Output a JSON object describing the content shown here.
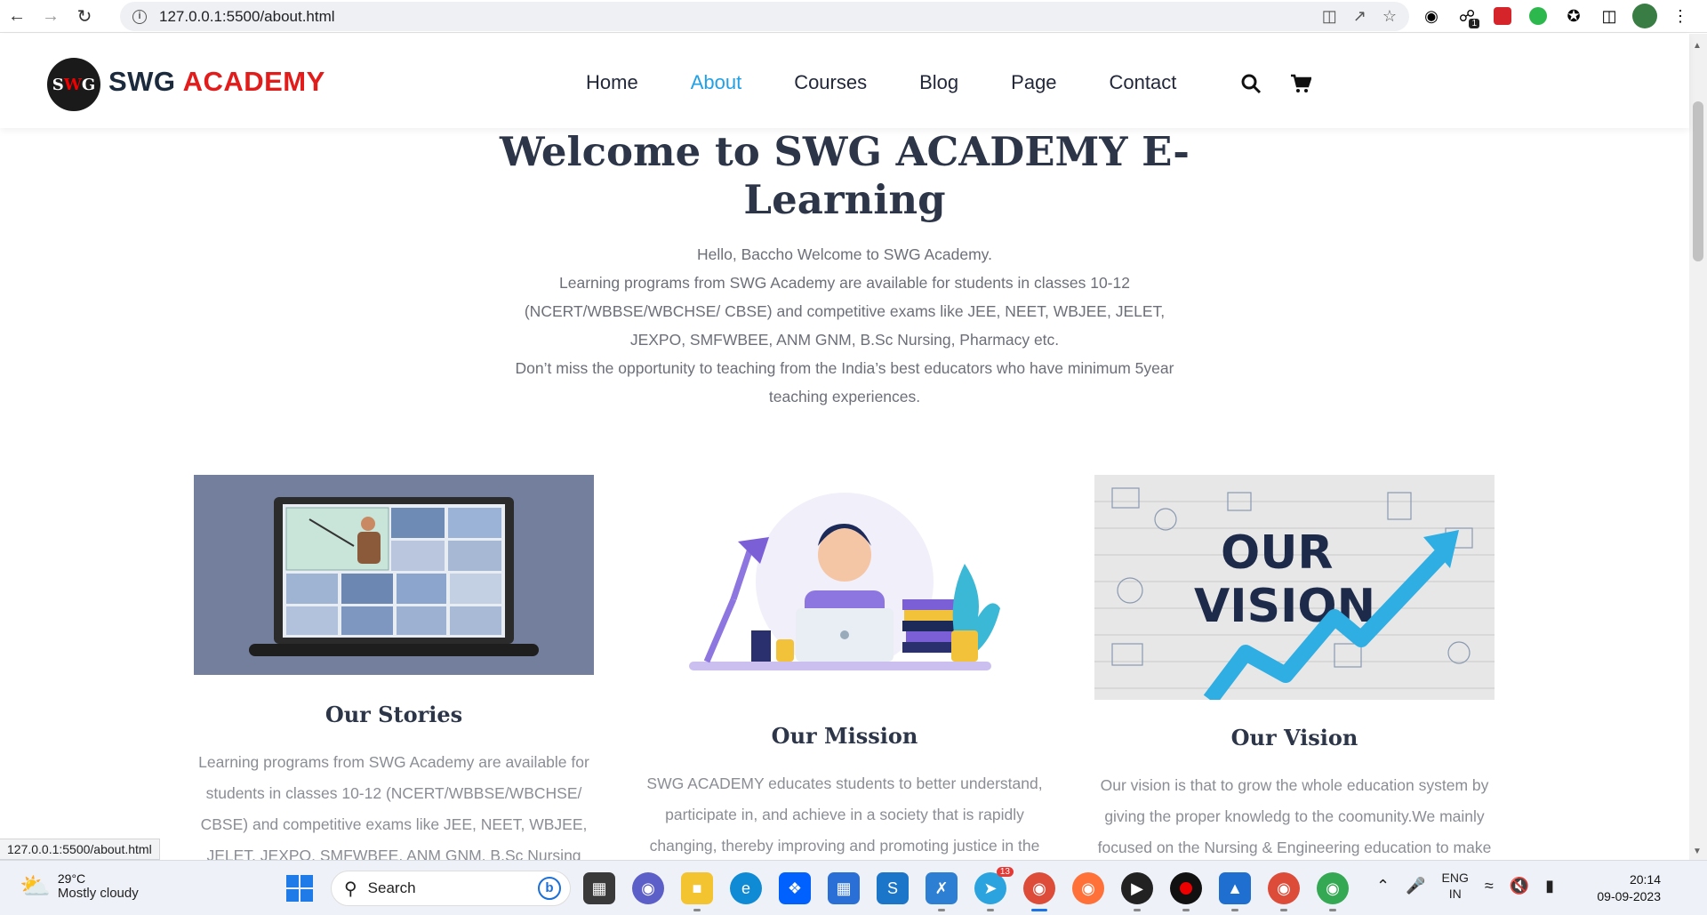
{
  "browser": {
    "url": "127.0.0.1:5500/about.html",
    "status_url": "127.0.0.1:5500/about.html",
    "extensions": [
      "cookie-icon",
      "link-icon",
      "pdf-icon",
      "green-app-icon",
      "puzzle-icon",
      "sidepanel-icon"
    ],
    "ext_badge": "1"
  },
  "header": {
    "logo_text_a": "S",
    "logo_text_b": "G",
    "logo_text_w": "W",
    "brand_part1": "SWG",
    "brand_part2": "ACADEMY",
    "menu": [
      {
        "label": "Home",
        "active": false
      },
      {
        "label": "About",
        "active": true
      },
      {
        "label": "Courses",
        "active": false
      },
      {
        "label": "Blog",
        "active": false
      },
      {
        "label": "Page",
        "active": false
      },
      {
        "label": "Contact",
        "active": false
      }
    ]
  },
  "hero": {
    "title": "Welcome to SWG ACADEMY E-Learning",
    "line1": "Hello, Baccho Welcome to SWG Academy.",
    "line2": "Learning programs from SWG Academy are available for students in classes 10-12 (NCERT/WBBSE/WBCHSE/ CBSE) and competitive exams like JEE, NEET, WBJEE, JELET, JEXPO, SMFWBEE, ANM GNM, B.Sc Nursing, Pharmacy etc.",
    "line3": "Don’t miss the opportunity to teaching from the India’s best educators who have minimum 5year teaching experiences."
  },
  "cards": [
    {
      "title": "Our Stories",
      "text": "Learning programs from SWG Academy are available for students in classes 10-12 (NCERT/WBBSE/WBCHSE/ CBSE) and competitive exams like JEE, NEET, WBJEE, JELET, JEXPO, SMFWBEE, ANM GNM, B.Sc Nursing"
    },
    {
      "title": "Our Mission",
      "text": "SWG ACADEMY educates students to better understand, participate in, and achieve in a society that is rapidly changing, thereby improving and promoting justice in the"
    },
    {
      "title": "Our Vision",
      "image_text_1": "OUR",
      "image_text_2": "VISION",
      "text": "Our vision is that to grow the whole education system by giving the proper knowledg to the coomunity.We mainly focused on the Nursing & Engineering education to make"
    }
  ],
  "taskbar": {
    "temperature": "29°C",
    "weather": "Mostly cloudy",
    "search_label": "Search",
    "telegram_badge": "13",
    "lang_1": "ENG",
    "lang_2": "IN",
    "time": "20:14",
    "date": "09-09-2023"
  },
  "colors": {
    "accent": "#21a0e6",
    "brand_red": "#e21b1b",
    "heading": "#2d3648"
  }
}
